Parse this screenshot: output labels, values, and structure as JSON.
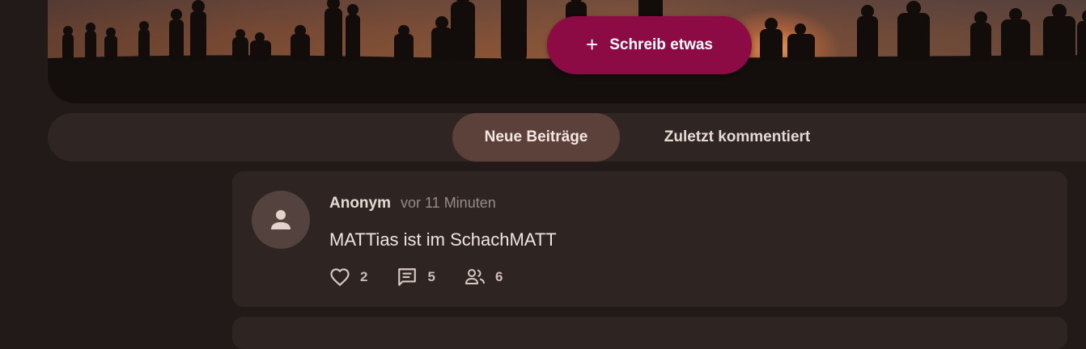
{
  "hero": {
    "write_label": "Schreib etwas"
  },
  "tabs": [
    {
      "label": "Neue Beiträge",
      "active": true
    },
    {
      "label": "Zuletzt kommentiert",
      "active": false
    }
  ],
  "post": {
    "author": "Anonym",
    "time": "vor 11 Minuten",
    "text": "MATTias ist im SchachMATT",
    "likes": "2",
    "comments": "5",
    "participants": "6"
  },
  "icons": {
    "write": "plus-icon",
    "avatar": "person-icon",
    "likes": "heart-icon",
    "comments": "comment-icon",
    "participants": "people-icon"
  },
  "colors": {
    "accent": "#8c0b44",
    "active_tab": "#5c403a",
    "card": "#2e2422",
    "background": "#211a18"
  }
}
